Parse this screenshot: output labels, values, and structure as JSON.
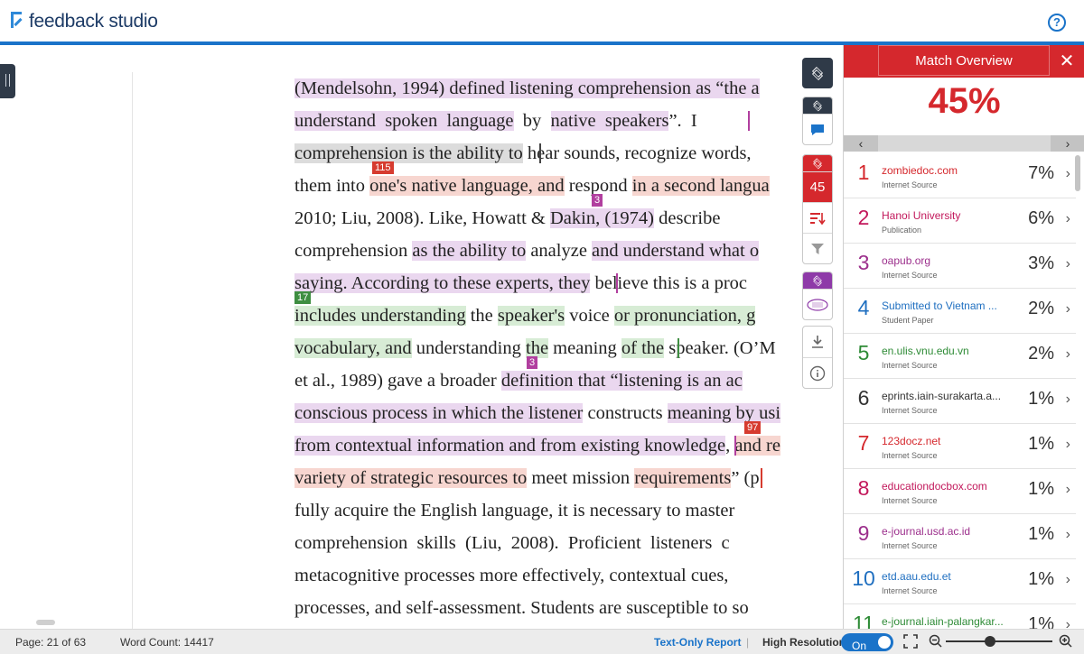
{
  "header": {
    "logo_text": "feedback studio",
    "help_label": "?"
  },
  "document": {
    "lines": [
      {
        "segs": [
          {
            "t": "(Mendelsohn, 1994) defined listening comprehension as “the a",
            "h": "p"
          }
        ]
      },
      {
        "segs": [
          {
            "t": "understand  spoken  language",
            "h": "p"
          },
          {
            "t": "  by  ",
            "h": ""
          },
          {
            "t": "native  speakers",
            "h": "p"
          },
          {
            "t": "”.  I",
            "h": ""
          }
        ]
      },
      {
        "segs": [
          {
            "t": "comprehension is the ability to",
            "h": "x"
          },
          {
            "t": " hear sounds, recognize words,",
            "h": ""
          }
        ]
      },
      {
        "segs": [
          {
            "t": "them into ",
            "h": ""
          },
          {
            "t": "one's native language, and",
            "h": "r"
          },
          {
            "t": " respond ",
            "h": ""
          },
          {
            "t": "in a second langua",
            "h": "r"
          }
        ]
      },
      {
        "segs": [
          {
            "t": "2010; Liu, 2008). Like, Howatt & ",
            "h": ""
          },
          {
            "t": "Dakin, (1974)",
            "h": "p"
          },
          {
            "t": " describe",
            "h": ""
          }
        ]
      },
      {
        "segs": [
          {
            "t": "comprehension ",
            "h": ""
          },
          {
            "t": "as the ability to",
            "h": "p"
          },
          {
            "t": " analyze ",
            "h": ""
          },
          {
            "t": "and understand what o",
            "h": "p"
          }
        ]
      },
      {
        "segs": [
          {
            "t": "saying. According to these experts, they",
            "h": "p"
          },
          {
            "t": " believe this is a proc",
            "h": ""
          }
        ]
      },
      {
        "segs": [
          {
            "t": "includes understanding",
            "h": "g"
          },
          {
            "t": " the ",
            "h": ""
          },
          {
            "t": "speaker's",
            "h": "g"
          },
          {
            "t": " voice ",
            "h": ""
          },
          {
            "t": "or pronunciation, g",
            "h": "g"
          }
        ]
      },
      {
        "segs": [
          {
            "t": "vocabulary, and",
            "h": "g"
          },
          {
            "t": " understanding ",
            "h": ""
          },
          {
            "t": "the",
            "h": "g"
          },
          {
            "t": " meaning ",
            "h": ""
          },
          {
            "t": "of the",
            "h": "g"
          },
          {
            "t": " speaker. (O’M",
            "h": ""
          }
        ]
      },
      {
        "segs": [
          {
            "t": "et al., 1989) gave a broader ",
            "h": ""
          },
          {
            "t": "definition that “listening is an ac",
            "h": "p"
          }
        ]
      },
      {
        "segs": [
          {
            "t": "conscious process in which the listener",
            "h": "p"
          },
          {
            "t": " constructs ",
            "h": ""
          },
          {
            "t": "meaning by usi",
            "h": "p"
          }
        ]
      },
      {
        "segs": [
          {
            "t": "from contextual information and from existing knowledge",
            "h": "p"
          },
          {
            "t": ", ",
            "h": ""
          },
          {
            "t": "and re",
            "h": "r"
          }
        ]
      },
      {
        "segs": [
          {
            "t": "variety of strategic resources to",
            "h": "r"
          },
          {
            "t": " meet mission ",
            "h": ""
          },
          {
            "t": "requirements",
            "h": "r"
          },
          {
            "t": "” (p",
            "h": ""
          }
        ]
      },
      {
        "segs": [
          {
            "t": "fully acquire the English language, it is necessary to master",
            "h": ""
          }
        ]
      },
      {
        "segs": [
          {
            "t": "comprehension  skills  (Liu,  2008).  Proficient  listeners  c",
            "h": ""
          }
        ]
      },
      {
        "segs": [
          {
            "t": "metacognitive processes more effectively, contextual cues,",
            "h": ""
          }
        ]
      },
      {
        "segs": [
          {
            "t": "processes, and self-assessment. Students are susceptible to so",
            "h": ""
          }
        ]
      }
    ],
    "tags": {
      "t115": "115",
      "t3a": "3",
      "t17": "17",
      "t3b": "3",
      "t97": "97"
    }
  },
  "toolbar": {
    "match_count": "45"
  },
  "panel": {
    "title": "Match Overview",
    "close_label": "✕",
    "overall_percent": "45%",
    "matches": [
      {
        "num": "1",
        "source": "zombiedoc.com",
        "type": "Internet Source",
        "pct": "7%",
        "color": "#d5282d"
      },
      {
        "num": "2",
        "source": "Hanoi University",
        "type": "Publication",
        "pct": "6%",
        "color": "#c2185b"
      },
      {
        "num": "3",
        "source": "oapub.org",
        "type": "Internet Source",
        "pct": "3%",
        "color": "#9c2f8c"
      },
      {
        "num": "4",
        "source": "Submitted to Vietnam ...",
        "type": "Student Paper",
        "pct": "2%",
        "color": "#1f6fc0"
      },
      {
        "num": "5",
        "source": "en.ulis.vnu.edu.vn",
        "type": "Internet Source",
        "pct": "2%",
        "color": "#2e8b36"
      },
      {
        "num": "6",
        "source": "eprints.iain-surakarta.a...",
        "type": "Internet Source",
        "pct": "1%",
        "color": "#333333"
      },
      {
        "num": "7",
        "source": "123docz.net",
        "type": "Internet Source",
        "pct": "1%",
        "color": "#d5282d"
      },
      {
        "num": "8",
        "source": "educationdocbox.com",
        "type": "Internet Source",
        "pct": "1%",
        "color": "#c2185b"
      },
      {
        "num": "9",
        "source": "e-journal.usd.ac.id",
        "type": "Internet Source",
        "pct": "1%",
        "color": "#9c2f8c"
      },
      {
        "num": "10",
        "source": "etd.aau.edu.et",
        "type": "Internet Source",
        "pct": "1%",
        "color": "#1f6fc0"
      },
      {
        "num": "11",
        "source": "e-journal.iain-palangkar...",
        "type": "",
        "pct": "1%",
        "color": "#2e8b36"
      }
    ]
  },
  "status": {
    "page": "Page: 21 of 63",
    "word_count": "Word Count: 14417",
    "text_only": "Text-Only Report",
    "high_res_label": "High Resolution",
    "toggle_state": "On",
    "zoom_level": 0.4
  },
  "colors": {
    "brand": "#1a73c9",
    "accent_red": "#d5282d",
    "toolbar_dark": "#2f3a48"
  }
}
